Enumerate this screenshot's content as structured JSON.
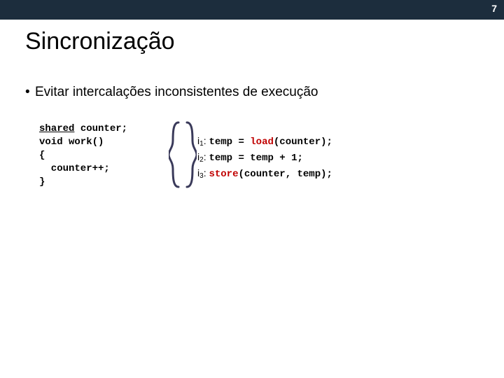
{
  "page_number": "7",
  "title": "Sincronização",
  "bullet": "Evitar intercalações inconsistentes de execução",
  "code_left": {
    "l1a": "shared",
    "l1b": " counter;",
    "l2": "void work()",
    "l3": "{",
    "l4": "  counter++;",
    "l5": "}"
  },
  "right": {
    "i1_label": "i",
    "i1_sub": "1",
    "i1_colon": ": ",
    "i1_a": "temp = ",
    "i1_load": "load",
    "i1_b": "(counter);",
    "i2_label": "i",
    "i2_sub": "2",
    "i2_colon": ": ",
    "i2_a": "temp = temp + 1;",
    "i3_label": "i",
    "i3_sub": "3",
    "i3_colon": ": ",
    "i3_store": "store",
    "i3_b": "(counter, temp);"
  }
}
